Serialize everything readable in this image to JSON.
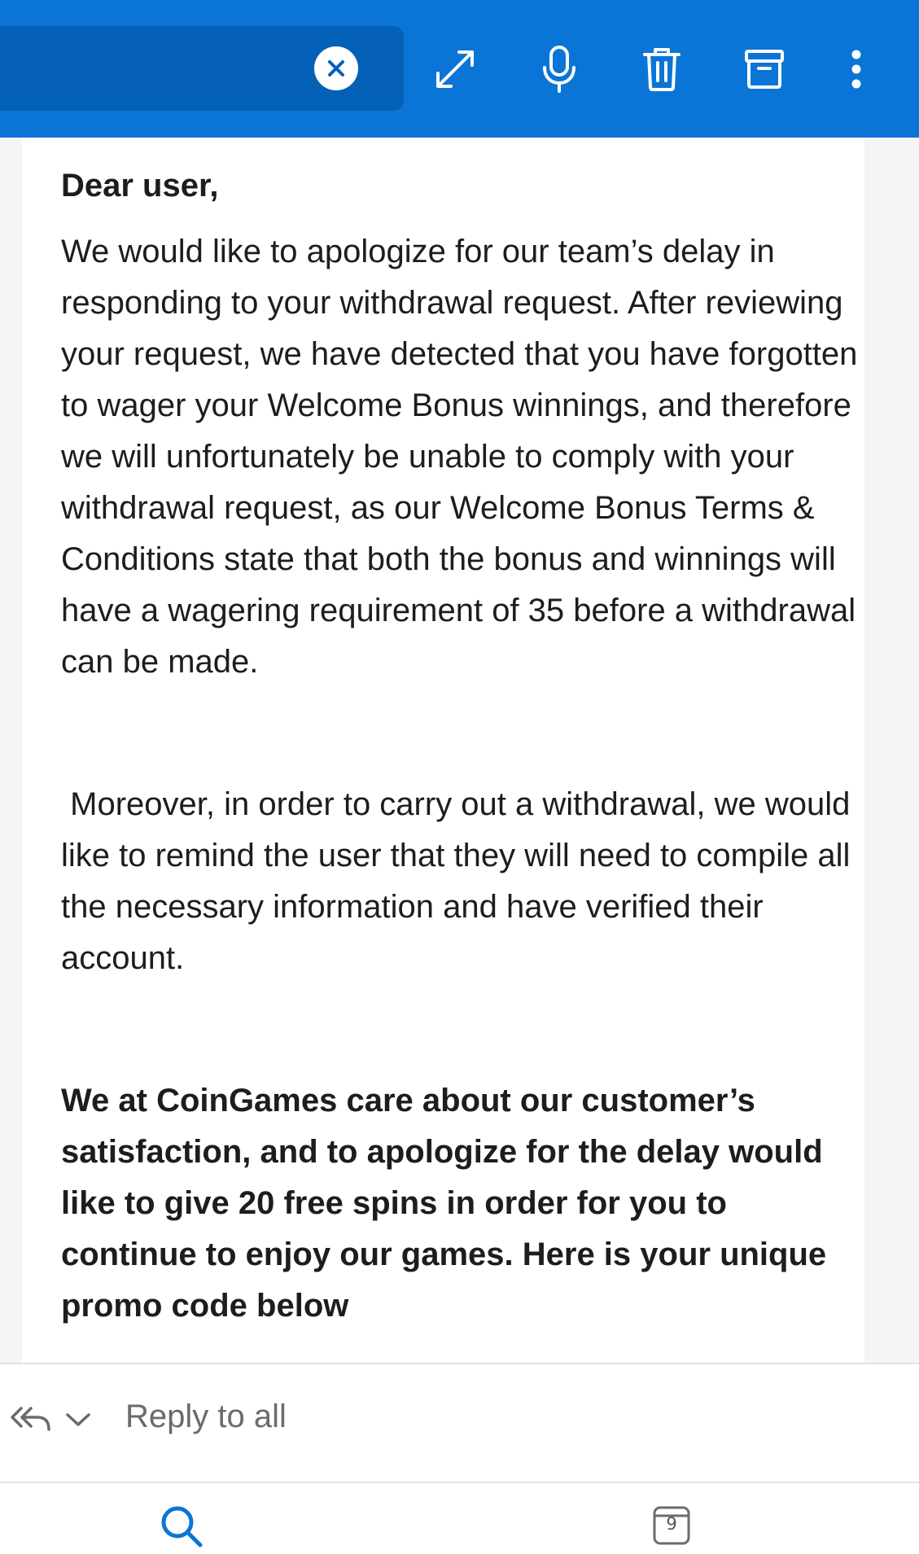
{
  "header": {
    "icons": [
      "close-icon",
      "expand-icon",
      "microphone-icon",
      "trash-icon",
      "archive-icon",
      "more-vertical-icon"
    ],
    "colors": {
      "bar": "#0a75d6",
      "search": "#0560b8"
    }
  },
  "email": {
    "greeting": "Dear user,",
    "paragraph1": "We would like to apologize for our team’s delay in responding to your withdrawal request. After reviewing your request, we have detected that you have forgotten to wager your Welcome Bonus winnings, and therefore we will unfortunately be unable to comply with your withdrawal request, as our Welcome Bonus Terms & Conditions state that both the bonus and winnings will have a wagering requirement of 35 before a withdrawal can be made.",
    "paragraph2": " Moreover, in order to carry out a withdrawal, we would like to remind the user that they will need to compile all the necessary information and have verified their account.",
    "paragraph3": "We at CoinGames care about our customer’s satisfaction, and to apologize for the delay would like to give 20 free spins in order for you to continue to enjoy our games. Here is your unique promo code below"
  },
  "reply": {
    "label": "Reply to all"
  },
  "bottom_nav": {
    "calendar_day": "9"
  }
}
